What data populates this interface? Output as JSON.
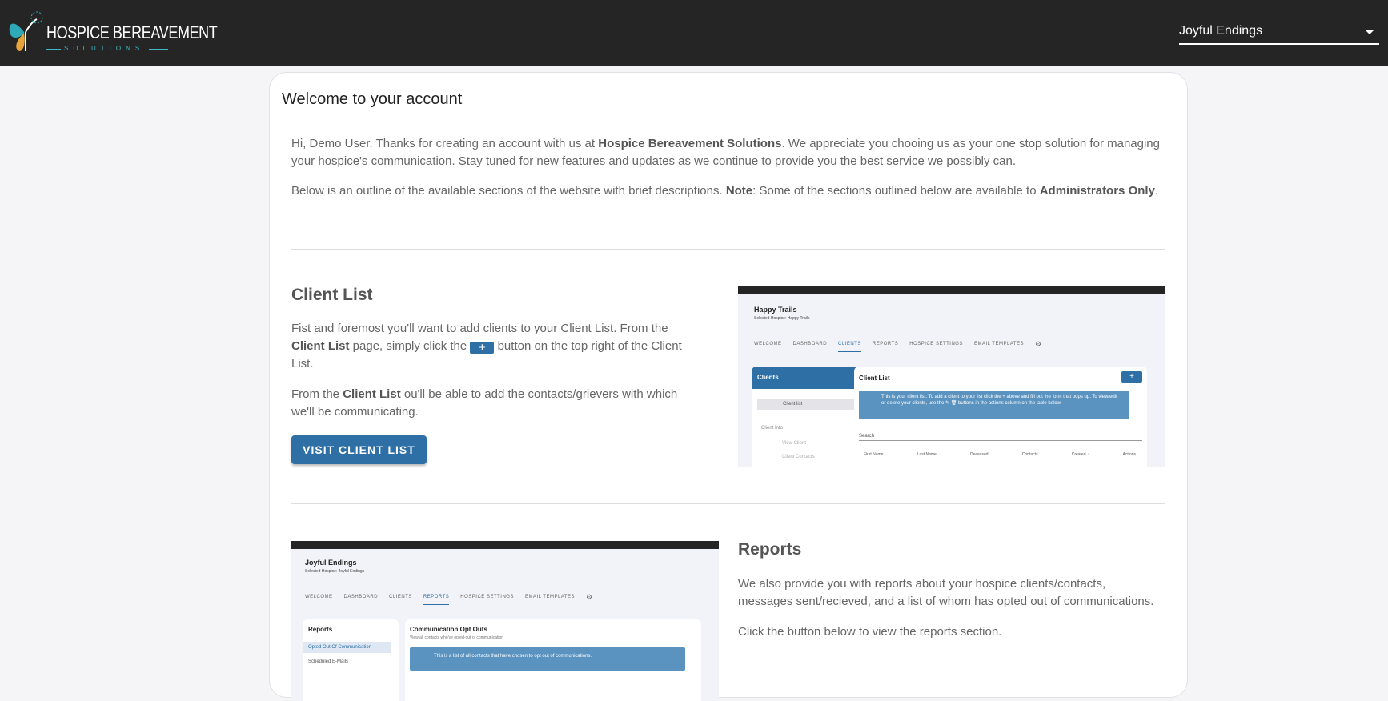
{
  "header": {
    "logo_text": "HOSPICE BEREAVEMENT",
    "logo_subtext": "SOLUTIONS",
    "hospice_selector": "Joyful Endings"
  },
  "card": {
    "title": "Welcome to your account",
    "intro_p1_a": "Hi, Demo User. Thanks for creating an account with us at ",
    "intro_p1_b": "Hospice Bereavement Solutions",
    "intro_p1_c": ". We appreciate you chooing us as your one stop solution for managing your hospice's communication. Stay tuned for new features and updates as we continue to provide you the best service we possibly can.",
    "intro_p2_a": "Below is an outline of the available sections of the website with brief descriptions. ",
    "intro_p2_b": "Note",
    "intro_p2_c": ": Some of the sections outlined below are available to ",
    "intro_p2_d": "Administrators Only",
    "intro_p2_e": "."
  },
  "client_list": {
    "title": "Client List",
    "p1_a": "Fist and foremost you'll want to add clients to your Client List. From the ",
    "p1_b": "Client List",
    "p1_c": " page, simply click the ",
    "p1_d": " button on the top right of the Client List.",
    "plus_glyph": "+",
    "p2_a": "From the ",
    "p2_b": "Client List",
    "p2_c": " ou'll be able to add the contacts/grievers with which we'll be communicating.",
    "button": "VISIT CLIENT LIST",
    "preview": {
      "hospice": "Happy Trails",
      "selected": "Selected Hospice: Happy Trails",
      "tabs": [
        "WELCOME",
        "DASHBOARD",
        "CLIENTS",
        "REPORTS",
        "HOSPICE SETTINGS",
        "EMAIL TEMPLATES"
      ],
      "active_tab": 2,
      "side_title": "Clients",
      "side_item": "Client list",
      "side_section": "Client Info",
      "side_sub1": "View Client",
      "side_sub2": "Client Contacts",
      "panel_title": "Client List",
      "info": "This is your client list. To add a client to your list click the + above and fill out the form that pops up. To view/edit or delete your clients, use the ✎ 🗑 buttons in the actions column on the table below.",
      "search": "Search",
      "columns": [
        "First Name",
        "Last Name",
        "Deceased",
        "Contacts",
        "Created ↓",
        "Actions"
      ]
    }
  },
  "reports": {
    "title": "Reports",
    "p1": "We also provide you with reports about your hospice clients/contacts, messages sent/recieved, and a list of whom has opted out of communications.",
    "p2": "Click the button below to view the reports section.",
    "preview": {
      "hospice": "Joyful Endings",
      "selected": "Selected Hospice: Joyful Endings",
      "tabs": [
        "WELCOME",
        "DASHBOARD",
        "CLIENTS",
        "REPORTS",
        "HOSPICE SETTINGS",
        "EMAIL TEMPLATES"
      ],
      "active_tab": 3,
      "side_title": "Reports",
      "side_item1": "Opted Out Of Communication",
      "side_item2": "Scheduled E-Mails",
      "panel_title": "Communication Opt Outs",
      "panel_sub": "View all contacts who've opted-out of communication",
      "info": "This is a list of all contacts that have chosen to opt out of communications."
    }
  },
  "colors": {
    "topbar": "#252525",
    "accent": "#2e6fa6",
    "logo_teal": "#3db7c4"
  }
}
